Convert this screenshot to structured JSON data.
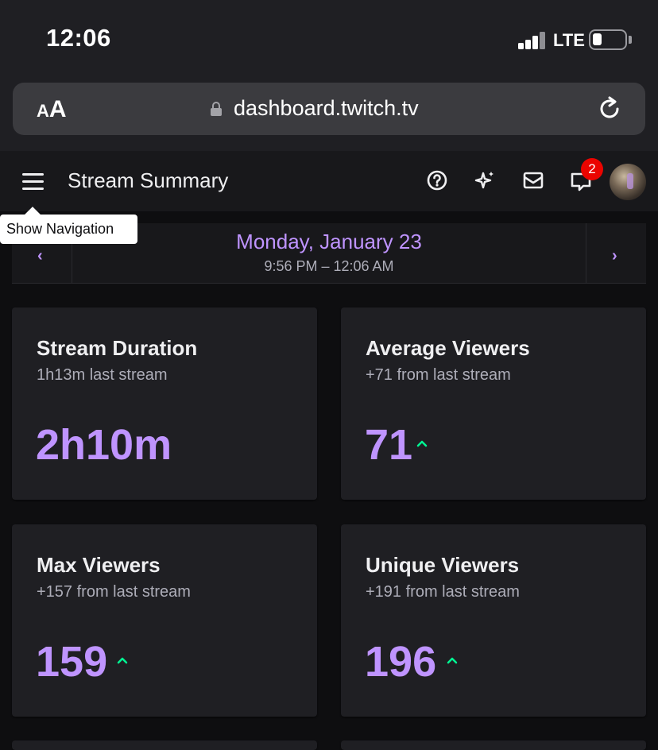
{
  "status_bar": {
    "time": "12:06",
    "carrier": "LTE"
  },
  "browser": {
    "text_size_label_small": "A",
    "text_size_label_large": "A",
    "url": "dashboard.twitch.tv"
  },
  "topnav": {
    "title": "Stream Summary",
    "notification_count": "2"
  },
  "tooltip": {
    "text": "Show Navigation"
  },
  "date_nav": {
    "date": "Monday, January 23",
    "range": "9:56 PM – 12:06 AM"
  },
  "cards": [
    {
      "title": "Stream Duration",
      "subtitle": "1h13m last stream",
      "value": "2h10m",
      "trend": "none"
    },
    {
      "title": "Average Viewers",
      "subtitle": "+71 from last stream",
      "value": "71",
      "trend": "up"
    },
    {
      "title": "Max Viewers",
      "subtitle": "+157 from last stream",
      "value": "159",
      "trend": "up"
    },
    {
      "title": "Unique Viewers",
      "subtitle": "+191 from last stream",
      "value": "196",
      "trend": "up"
    }
  ],
  "colors": {
    "accent": "#bf94ff",
    "trend_up": "#00f593",
    "badge": "#eb0400",
    "card_bg": "#1f1f23",
    "page_bg": "#0e0e10"
  }
}
